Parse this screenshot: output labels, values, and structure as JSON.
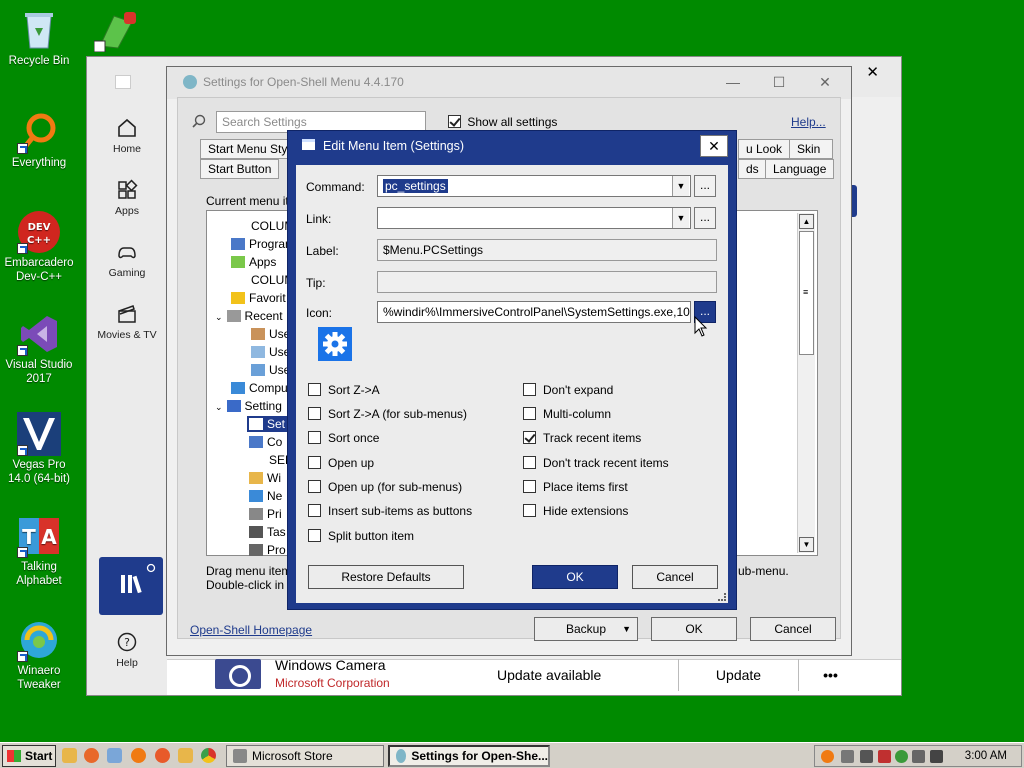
{
  "desktop": {
    "icons": [
      {
        "label": "Recycle Bin"
      },
      {
        "label": "Everything"
      },
      {
        "label": "Embarcadero Dev-C++"
      },
      {
        "label": "Visual Studio 2017"
      },
      {
        "label": "Vegas Pro 14.0 (64-bit)"
      },
      {
        "label": "Talking Alphabet"
      },
      {
        "label": "Winaero Tweaker"
      }
    ]
  },
  "store": {
    "nav": [
      {
        "label": "Home",
        "icon": "home-icon"
      },
      {
        "label": "Apps",
        "icon": "apps-icon"
      },
      {
        "label": "Gaming",
        "icon": "gamepad-icon"
      },
      {
        "label": "Movies & TV",
        "icon": "movies-icon"
      },
      {
        "label": "Help",
        "icon": "help-icon"
      }
    ],
    "app_title": "Windows Camera",
    "app_publisher": "Microsoft Corporation",
    "status": "Update available",
    "update_label": "Update",
    "more_label": "•••"
  },
  "settings": {
    "title": "Settings for Open-Shell Menu 4.4.170",
    "search_placeholder": "Search Settings",
    "show_all_label": "Show all settings",
    "help_link": "Help...",
    "tabs_row1": [
      "Start Menu Style",
      "u Look",
      "Skin"
    ],
    "tabs_row2": [
      "Start Button",
      "ds",
      "Language"
    ],
    "current_label": "Current menu it",
    "tree": [
      "COLUM",
      "Program",
      "Apps",
      "COLUM",
      "Favorit",
      "Recent",
      "Use",
      "Use",
      "Use",
      "Compu",
      "Setting",
      "Set",
      "Co",
      "SEP",
      "Wi",
      "Ne",
      "Pri",
      "Tas",
      "Pro"
    ],
    "drag_hint": "Drag menu item",
    "dbl_hint": "Double-click in",
    "submenu_hint": "ub-menu.",
    "homepage_link": "Open-Shell Homepage",
    "backup_label": "Backup",
    "ok_label": "OK",
    "cancel_label": "Cancel"
  },
  "dialog": {
    "title": "Edit Menu Item (Settings)",
    "command_label": "Command:",
    "command_value": "pc_settings",
    "link_label": "Link:",
    "link_value": "",
    "label_label": "Label:",
    "label_value": "$Menu.PCSettings",
    "tip_label": "Tip:",
    "tip_value": "",
    "icon_label": "Icon:",
    "icon_value": "%windir%\\ImmersiveControlPanel\\SystemSettings.exe,10",
    "browse_label": "...",
    "options_left": [
      {
        "label": "Sort Z->A",
        "checked": false
      },
      {
        "label": "Sort Z->A (for sub-menus)",
        "checked": false
      },
      {
        "label": "Sort once",
        "checked": false
      },
      {
        "label": "Open up",
        "checked": false
      },
      {
        "label": "Open up (for sub-menus)",
        "checked": false
      },
      {
        "label": "Insert sub-items as buttons",
        "checked": false
      },
      {
        "label": "Split button item",
        "checked": false
      }
    ],
    "options_right": [
      {
        "label": "Don't expand",
        "checked": false
      },
      {
        "label": "Multi-column",
        "checked": false
      },
      {
        "label": "Track recent items",
        "checked": true
      },
      {
        "label": "Don't track recent items",
        "checked": false
      },
      {
        "label": "Place items first",
        "checked": false
      },
      {
        "label": "Hide extensions",
        "checked": false
      }
    ],
    "restore_label": "Restore Defaults",
    "ok_label": "OK",
    "cancel_label": "Cancel"
  },
  "taskbar": {
    "start_label": "Start",
    "tasks": [
      {
        "label": "Microsoft Store"
      },
      {
        "label": "Settings for Open-She..."
      }
    ],
    "clock": "3:00 AM"
  }
}
